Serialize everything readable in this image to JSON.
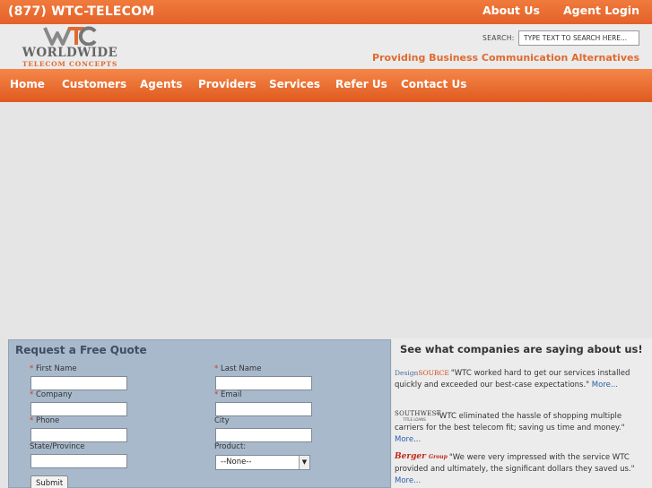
{
  "topbar": {
    "phone": "(877) WTC-TELECOM",
    "links": [
      "About Us",
      "Agent Login"
    ]
  },
  "header": {
    "logo_monogram": "WTC",
    "logo_word": "WORLDWIDE",
    "logo_sub": "TELECOM CONCEPTS",
    "search_label": "SEARCH:",
    "search_placeholder": "TYPE TEXT TO SEARCH HERE...",
    "tagline": "Providing Business Communication Alternatives"
  },
  "nav": {
    "items": [
      "Home",
      "Customers",
      "Agents",
      "Providers",
      "Services",
      "Refer Us",
      "Contact Us"
    ]
  },
  "quote": {
    "title": "Request a Free Quote",
    "required_mark": "*",
    "fields": {
      "first_name": "First Name",
      "last_name": "Last Name",
      "company": "Company",
      "email": "Email",
      "phone": "Phone",
      "city": "City",
      "state": "State/Province",
      "product": "Product:"
    },
    "product_selected": "--None--",
    "submit_label": "Submit"
  },
  "testimonials": {
    "title": "See what companies are saying about us!",
    "more_label": "More...",
    "items": [
      {
        "logo": "DesignSOURCE",
        "logo_a": "Design",
        "logo_b": "SOURCE",
        "icon": "designsource-logo-icon",
        "quote": "\"WTC worked hard to get our services installed quickly and exceeded our best-case expectations.\" "
      },
      {
        "logo": "SOUTHWEST",
        "logo_sub": "TITLE LOANS",
        "icon": "southwest-logo-icon",
        "quote": "\"WTC eliminated the hassle of shopping multiple carriers for the best telecom fit; saving us time and money.\" "
      },
      {
        "logo": "Berger",
        "logo_sub": "Group",
        "icon": "berger-group-logo-icon",
        "quote": "\"We were very impressed with the service WTC provided and ultimately, the significant dollars they saved us.\" "
      }
    ]
  },
  "colors": {
    "brand_orange": "#e4622a",
    "form_blue": "#a8b9cb",
    "link_blue": "#2a5ea8"
  }
}
